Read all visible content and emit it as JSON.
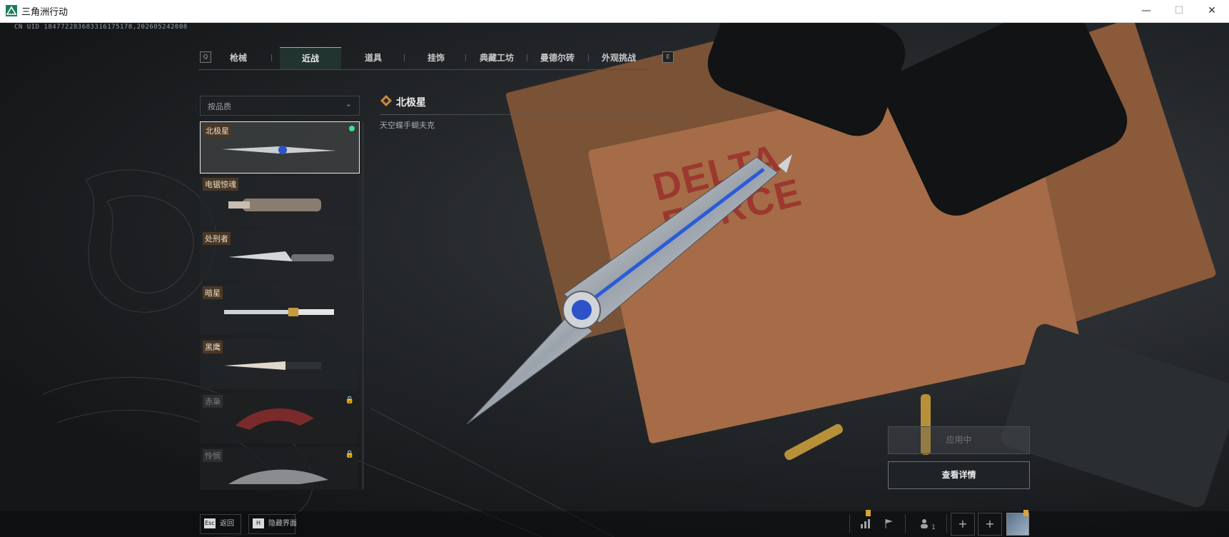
{
  "window": {
    "title": "三角洲行动",
    "minimize": "—",
    "maximize": "☐",
    "close": "✕"
  },
  "uid": "CN UID 184772283683316175178,202605242008",
  "tabs": {
    "left_key": "Q",
    "right_key": "E",
    "items": [
      {
        "label": "枪械",
        "active": false
      },
      {
        "label": "近战",
        "active": true
      },
      {
        "label": "道具",
        "active": false
      },
      {
        "label": "挂饰",
        "active": false
      },
      {
        "label": "典藏工坊",
        "active": false
      },
      {
        "label": "曼德尔砖",
        "active": false
      },
      {
        "label": "外观挑战",
        "active": false
      }
    ]
  },
  "filter": {
    "label": "按品质",
    "chevron": "⌄"
  },
  "weapon_list": [
    {
      "name": "北极星",
      "selected": true,
      "equipped": true,
      "locked": false
    },
    {
      "name": "电锯惊魂",
      "selected": false,
      "equipped": false,
      "locked": false
    },
    {
      "name": "处刑者",
      "selected": false,
      "equipped": false,
      "locked": false
    },
    {
      "name": "暗星",
      "selected": false,
      "equipped": false,
      "locked": false
    },
    {
      "name": "黑鹰",
      "selected": false,
      "equipped": false,
      "locked": false
    },
    {
      "name": "赤枭",
      "selected": false,
      "equipped": false,
      "locked": true
    },
    {
      "name": "怜悯",
      "selected": false,
      "equipped": false,
      "locked": true
    }
  ],
  "selected_weapon": {
    "name": "北极星",
    "subtitle": "天空蝶手蝴夫克"
  },
  "actions": {
    "apply_label": "应用中",
    "detail_label": "查看详情"
  },
  "bottom_bar": {
    "esc_key": "Esc",
    "back_label": "返回",
    "hide_key": "H",
    "hide_label": "隐藏界面",
    "friends_count": "1",
    "plus1": "+",
    "plus2": "+"
  },
  "colors": {
    "accent": "#4fd6a4",
    "equipped_dot": "#3fe08f",
    "stamp_red": "#9a2f2b"
  },
  "icons": [
    "app-icon",
    "chevron-down-icon",
    "lock-icon",
    "diamond-icon",
    "stats-icon",
    "flag-icon",
    "friends-icon",
    "plus-icon"
  ]
}
